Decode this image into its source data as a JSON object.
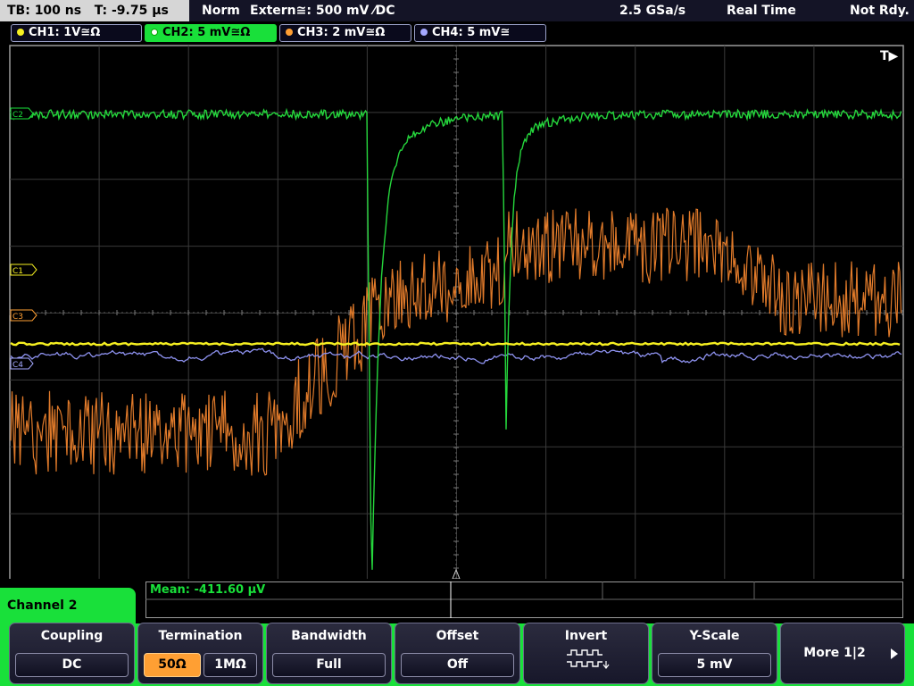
{
  "status": {
    "timebase": "TB: 100 ns",
    "trigger_time": "T: -9.75 µs",
    "mode": "Norm",
    "trigger": "Extern≅: 500 mV ⁄DC",
    "sample_rate": "2.5 GSa/s",
    "acquisition": "Real Time",
    "ready": "Not Rdy."
  },
  "channels": [
    {
      "label": "CH1: 1V≅Ω",
      "color": "#f6f021"
    },
    {
      "label": "CH2: 5 mV≅Ω",
      "color": "#19e03a"
    },
    {
      "label": "CH3: 2 mV≅Ω",
      "color": "#ff9f33"
    },
    {
      "label": "CH4: 5 mV≅",
      "color": "#a4a8ff"
    }
  ],
  "markers": {
    "trigger": "T▶",
    "c1": "C1",
    "c3": "C3",
    "c4": "C4",
    "c2": "C2"
  },
  "measurement": {
    "label": "Mean: -411.60 µV"
  },
  "menu": {
    "title": "Channel 2",
    "coupling": {
      "title": "Coupling",
      "value": "DC"
    },
    "termination": {
      "title": "Termination",
      "opt1": "50Ω",
      "opt2": "1MΩ"
    },
    "bandwidth": {
      "title": "Bandwidth",
      "value": "Full"
    },
    "offset": {
      "title": "Offset",
      "value": "Off"
    },
    "invert": {
      "title": "Invert"
    },
    "yscale": {
      "title": "Y-Scale",
      "value": "5 mV"
    },
    "more": {
      "label": "More 1|2"
    }
  }
}
